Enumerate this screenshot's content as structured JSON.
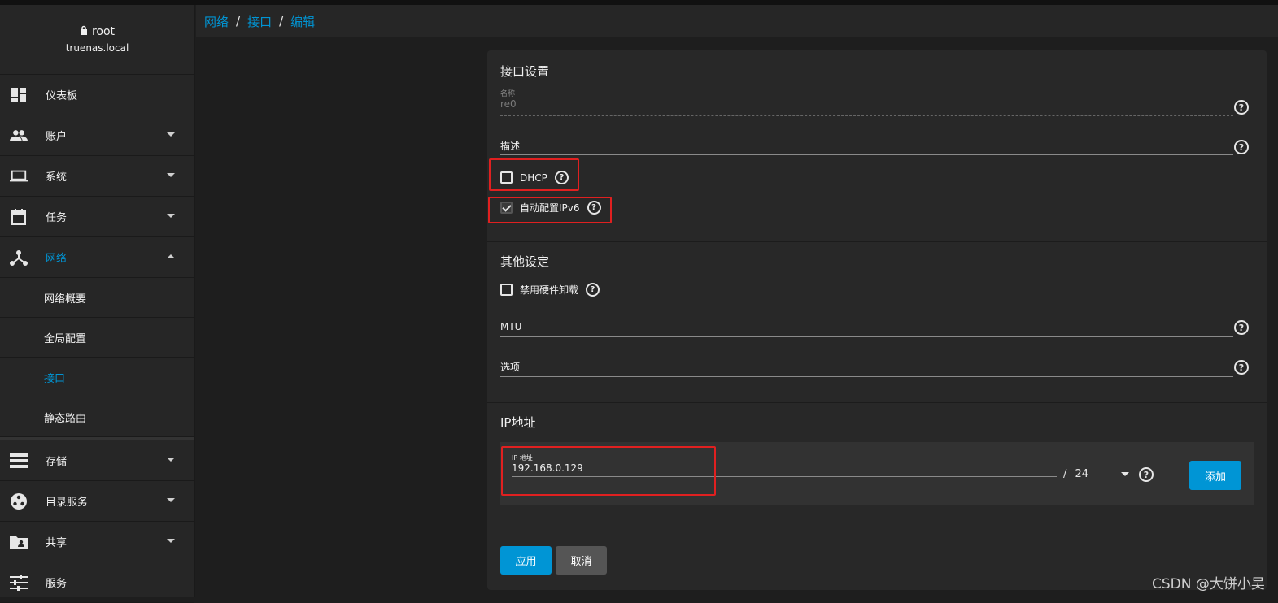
{
  "colors": {
    "accent": "#0095d5",
    "highlight": "#e02020"
  },
  "user": {
    "name": "root",
    "host": "truenas.local",
    "icon": "lock-icon"
  },
  "sidebar": {
    "items": [
      {
        "label": "仪表板",
        "icon": "dashboard-icon"
      },
      {
        "label": "账户",
        "icon": "accounts-icon"
      },
      {
        "label": "系统",
        "icon": "laptop-icon"
      },
      {
        "label": "任务",
        "icon": "calendar-icon"
      },
      {
        "label": "网络",
        "icon": "network-icon"
      },
      {
        "label": "存储",
        "icon": "storage-icon"
      },
      {
        "label": "目录服务",
        "icon": "directory-icon"
      },
      {
        "label": "共享",
        "icon": "share-folder-icon"
      },
      {
        "label": "服务",
        "icon": "tune-icon"
      }
    ],
    "network_sub": [
      "网络概要",
      "全局配置",
      "接口",
      "静态路由"
    ]
  },
  "breadcrumb": {
    "items": [
      "网络",
      "接口",
      "编辑"
    ],
    "sep": "/"
  },
  "form": {
    "section1": "接口设置",
    "name_label": "名称",
    "name_value": "re0",
    "desc_label": "描述",
    "dhcp_label": "DHCP",
    "ipv6_label": "自动配置IPv6",
    "section2": "其他设定",
    "hw_offload_label": "禁用硬件卸载",
    "mtu_label": "MTU",
    "options_label": "选项",
    "section3": "IP地址",
    "ip_label": "IP 地址",
    "ip_value": "192.168.0.129",
    "mask_sep": "/",
    "mask_value": "24",
    "add_label": "添加",
    "apply_label": "应用",
    "cancel_label": "取消",
    "help_glyph": "?"
  },
  "watermark": "CSDN @大饼小吴"
}
